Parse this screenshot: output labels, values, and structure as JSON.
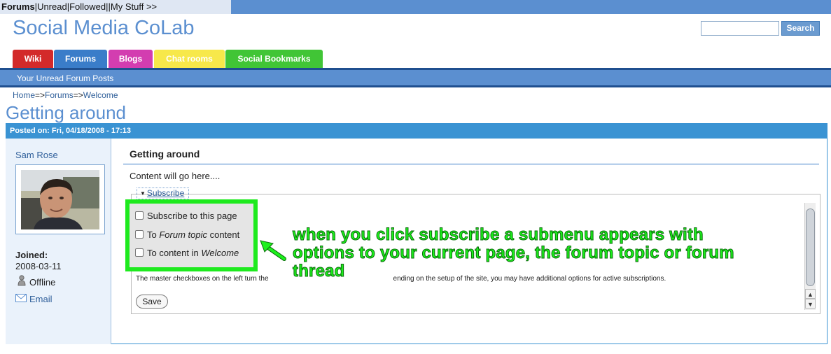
{
  "topnav": {
    "forums": "Forums",
    "separator": "|",
    "unread": "Unread",
    "followed": "Followed",
    "my_stuff": "My Stuff >>"
  },
  "site": {
    "title": "Social Media CoLab"
  },
  "search": {
    "value": "",
    "button_label": "Search"
  },
  "tabs": {
    "wiki": "Wiki",
    "forums": "Forums",
    "blogs": "Blogs",
    "chat": "Chat rooms",
    "bookmarks": "Social Bookmarks"
  },
  "subnav": {
    "label": "Your Unread Forum Posts"
  },
  "breadcrumb": {
    "home": "Home",
    "arrow": "=>",
    "forums": "Forums",
    "welcome": "Welcome"
  },
  "page": {
    "title": "Getting around"
  },
  "post": {
    "posted_on": "Posted on: Fri, 04/18/2008 - 17:13",
    "subject": "Getting around",
    "body": "Content will go here...."
  },
  "author": {
    "name": "Sam Rose",
    "joined_label": "Joined:",
    "joined_date": "2008-03-11",
    "status": "Offline",
    "email_label": "Email"
  },
  "subscribe": {
    "toggle_label": "Subscribe",
    "option_page": "Subscribe to this page",
    "option_topic_prefix": "To ",
    "option_topic_italic": "Forum topic",
    "option_topic_suffix": " content",
    "option_content_prefix": "To content in ",
    "option_content_italic": "Welcome",
    "help_left": "The master checkboxes on the left turn the",
    "help_right": "ending on the setup of the site, you may have additional options for active subscriptions.",
    "save_label": "Save"
  },
  "annotation": {
    "text": "when you click subscribe a submenu appears with options to your current page, the forum topic or forum thread",
    "color": "#1cf01c"
  },
  "colors": {
    "brand_blue": "#5b8fd0",
    "post_header": "#3a93d3",
    "tab_wiki": "#d32a2a",
    "tab_forums": "#3a7dc9",
    "tab_blogs": "#d33db0",
    "tab_chat": "#f7e84a",
    "tab_bookmarks": "#41c536"
  }
}
